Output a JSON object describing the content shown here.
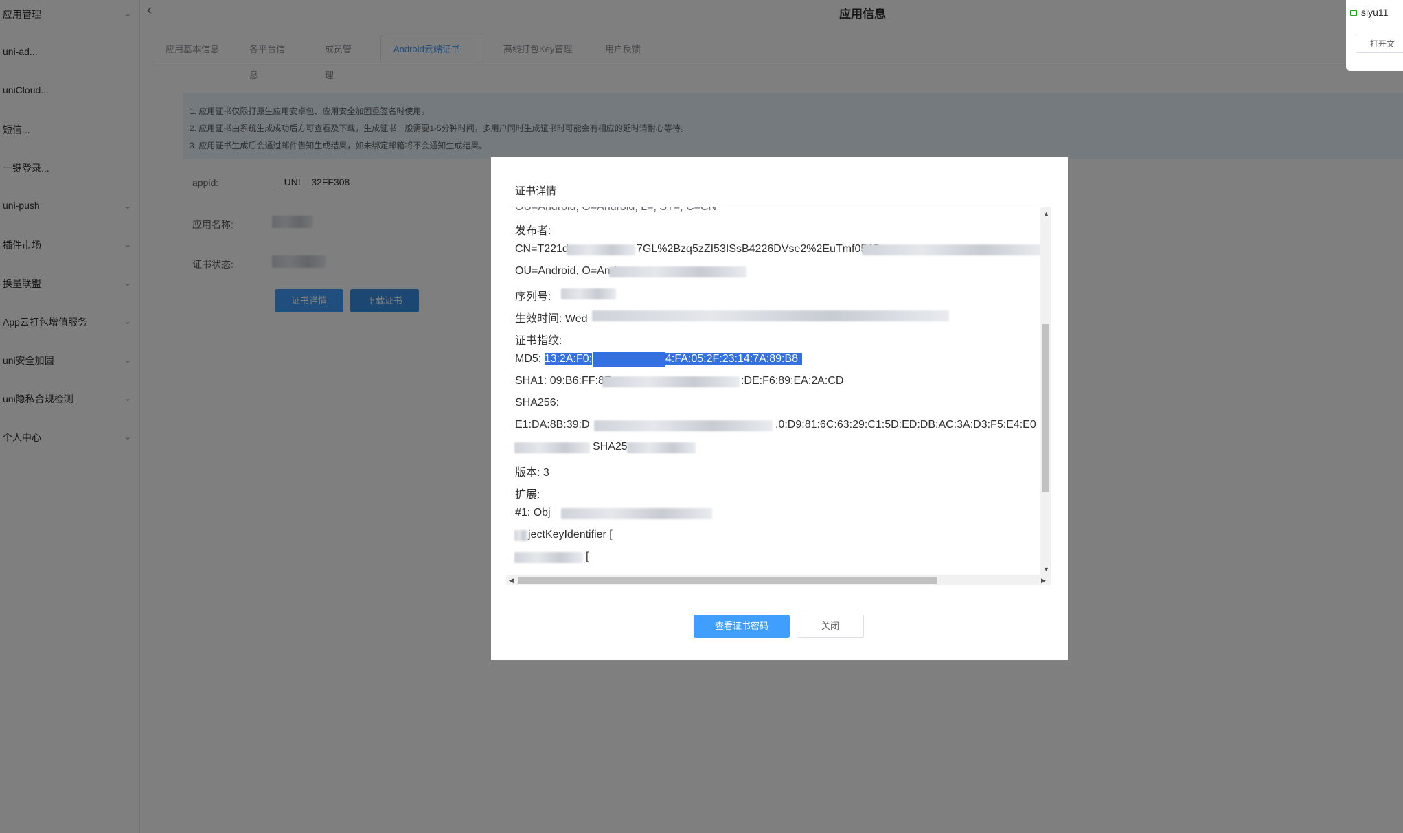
{
  "sidebar": {
    "items": [
      {
        "label": "应用管理",
        "chevron": true
      },
      {
        "label": "uni-ad...",
        "chevron": false
      },
      {
        "label": "uniCloud...",
        "chevron": false
      },
      {
        "label": "短信...",
        "chevron": false
      },
      {
        "label": "一键登录...",
        "chevron": false
      },
      {
        "label": "uni-push",
        "chevron": true
      },
      {
        "label": "插件市场",
        "chevron": true
      },
      {
        "label": "换量联盟",
        "chevron": true
      },
      {
        "label": "App云打包增值服务",
        "chevron": true
      },
      {
        "label": "uni安全加固",
        "chevron": true
      },
      {
        "label": "uni隐私合规检测",
        "chevron": true
      },
      {
        "label": "个人中心",
        "chevron": true
      }
    ]
  },
  "header": {
    "title": "应用信息",
    "back_icon": "chevron-left-icon"
  },
  "tabs": [
    {
      "label": "应用基本信息",
      "active": false
    },
    {
      "label": "各平台信息",
      "active": false
    },
    {
      "label": "成员管理",
      "active": false
    },
    {
      "label": "Android云端证书",
      "active": true
    },
    {
      "label": "离线打包Key管理",
      "active": false
    },
    {
      "label": "用户反馈",
      "active": false
    }
  ],
  "notice": {
    "lines": [
      "1. 应用证书仅限打原生应用安卓包、应用安全加固重签名时使用。",
      "2. 应用证书由系统生成成功后方可查看及下载，生成证书一般需要1-5分钟时间，多用户同时生成证书时可能会有相应的延时请耐心等待。",
      "3. 应用证书生成后会通过邮件告知生成结果，如未绑定邮箱将不会通知生成结果。"
    ]
  },
  "info": {
    "appid_label": "appid:",
    "appid_value": "__UNI__32FF308",
    "name_label": "应用名称:",
    "status_label": "证书状态:"
  },
  "buttons": {
    "detail": "证书详情",
    "download": "下载证书"
  },
  "modal": {
    "title": "证书详情",
    "lines": {
      "top_cut": "OU=Android, O=Android, L=, ST=, C=CN",
      "publisher": "发布者:",
      "cn_prefix": "CN=T221d",
      "cn_mid": "7GL%2Bzq5zZI53ISsB4226DVse2%2EuTmf054B",
      "ou": "OU=Android, O=Andr",
      "serial": "序列号:",
      "valid": "生效时间:",
      "valid_value": "Wed",
      "fingerprint": "证书指纹:",
      "md5_label": "MD5:",
      "md5_a": "13:2A:F0:",
      "md5_b": "4:FA:05:2F:23:14:7A:89:B8",
      "sha1_a": "SHA1: 09:B6:FF:8F",
      "sha1_b": ":DE:F6:89:EA:2A:CD",
      "sha256_label": "SHA256:",
      "sha256_a": "E1:DA:8B:39:D",
      "sha256_b": ".0:D9:81:6C:63:29:C1:5D:ED:DB:AC:3A:D3:F5:E4:E0",
      "sig": "SHA25",
      "version": "版本:",
      "version_value": "3",
      "extension": "扩展:",
      "ext1": "#1: Obj",
      "subject_key": "jectKeyIdentifier [",
      "bracket": "["
    },
    "primary_button": "查看证书密码",
    "close_button": "关闭"
  },
  "popup": {
    "user": "siyu11",
    "button": "打开文"
  },
  "colors": {
    "accent": "#409eff",
    "selection": "#3370e0",
    "notice_bg": "#e9f4fb"
  }
}
